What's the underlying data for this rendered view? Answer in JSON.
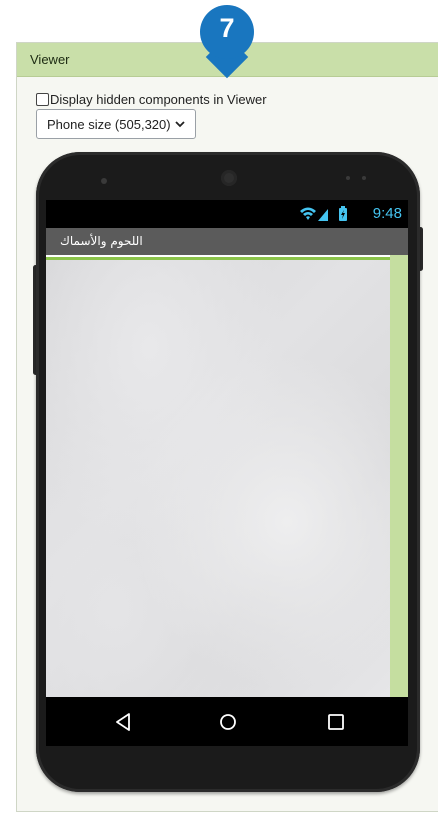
{
  "step_badge": "7",
  "panel": {
    "title": "Viewer",
    "checkbox_label": "Display hidden components in Viewer",
    "checkbox_checked": false,
    "phone_size_select": "Phone size (505,320)"
  },
  "device": {
    "status_time": "9:48",
    "app_title": "اللحوم والأسماك",
    "nav_buttons": [
      "back-icon",
      "home-icon",
      "recents-icon"
    ]
  },
  "colors": {
    "header_green": "#c9dfa9",
    "badge_blue": "#1976bf",
    "status_blue": "#45c4f0",
    "accent_green": "#8bc34a"
  }
}
